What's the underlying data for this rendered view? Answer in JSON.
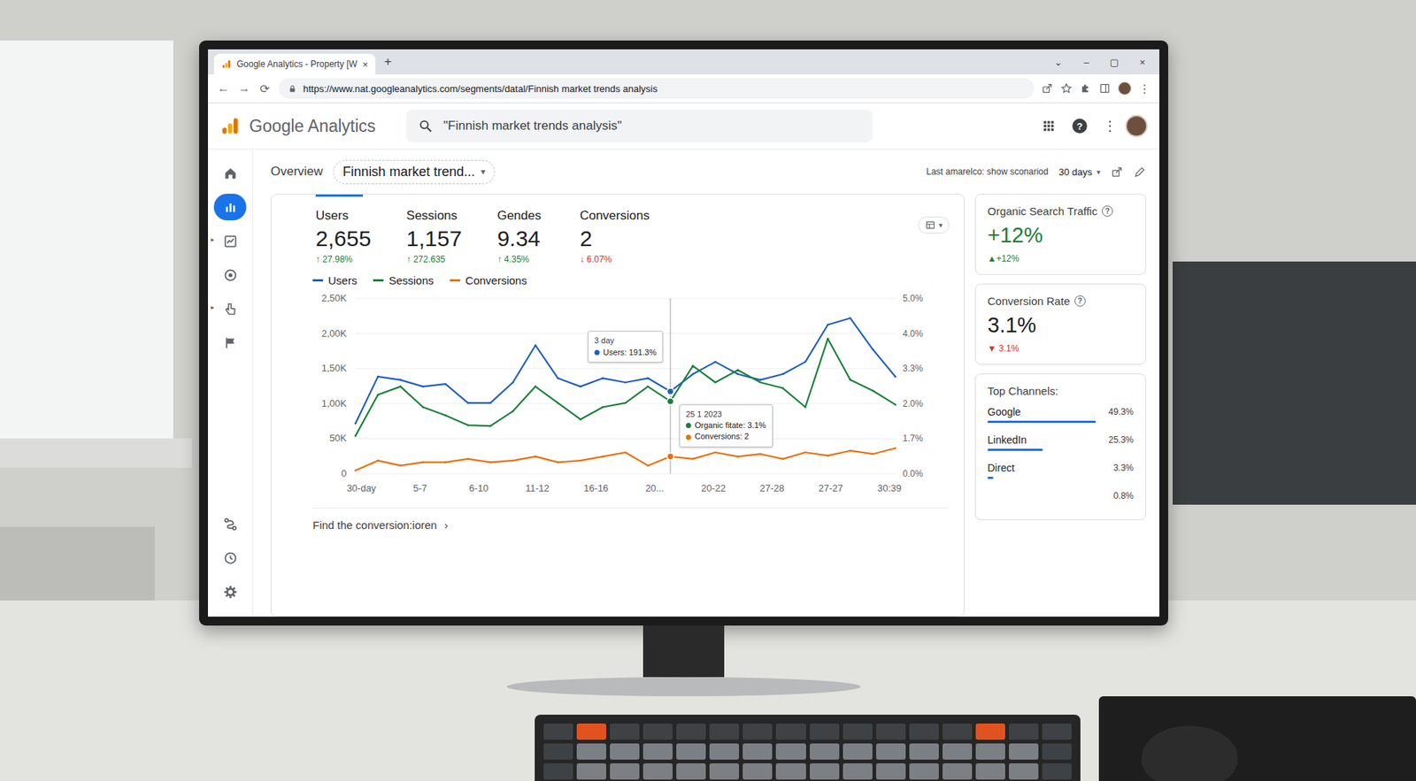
{
  "browser": {
    "tab": {
      "title": "Google Analytics - Property [W",
      "close": "×"
    },
    "new_tab": "+",
    "nav": [
      "←",
      "→",
      "⟳"
    ],
    "url": "https://www.nat.googleanalytics.com/segments/datal/Finnish market trends analysis",
    "menu": "⋮",
    "window_controls": [
      "⌄",
      "–",
      "▢",
      "×"
    ]
  },
  "header": {
    "logo": "Google Analytics",
    "search": "\"Finnish market trends analysis\"",
    "help": "?",
    "more": "⋮"
  },
  "sidebar": {
    "items": [
      {
        "selected": false
      },
      {
        "selected": true
      },
      {
        "selected": false,
        "arrow": "▸"
      },
      {
        "selected": false
      },
      {
        "selected": false,
        "arrow": "▸"
      },
      {
        "selected": false
      }
    ],
    "bottom": [
      {
        "selected": false
      },
      {
        "selected": false
      },
      {
        "selected": false
      }
    ]
  },
  "toolbar": {
    "overview": "Overview",
    "segment": "Finnish market trend...",
    "segment_arrow": "▾",
    "date_label": "Last amarelco: show sconariod",
    "date_value": "30 days",
    "date_arrow": "▾"
  },
  "metrics": [
    {
      "label": "Users",
      "value": "2,655",
      "delta": "↑ 27.98%",
      "trend": "up",
      "selected": true
    },
    {
      "label": "Sessions",
      "value": "1,157",
      "delta": "↑ 272.635",
      "trend": "up",
      "selected": false
    },
    {
      "label": "Gendes",
      "value": "9.34",
      "delta": "↑ 4.35%",
      "trend": "up",
      "selected": false
    },
    {
      "label": "Conversions",
      "value": "2",
      "delta": "↓ 6.07%",
      "trend": "down",
      "selected": false
    }
  ],
  "chart": {
    "menu_arrow": "▾",
    "series": [
      {
        "name": "Users",
        "color": "#1f5fbf",
        "values": [
          716,
          1385,
          1338,
          1244,
          1279,
          1009,
          1009,
          1303,
          1831,
          1362,
          1244,
          1362,
          1303,
          1362,
          1174,
          1420,
          1596,
          1420,
          1338,
          1420,
          1596,
          2124,
          2218,
          1772,
          1385
        ]
      },
      {
        "name": "Sessions",
        "color": "#188038",
        "values": [
          540,
          1127,
          1244,
          951,
          833,
          692,
          681,
          892,
          1244,
          1009,
          775,
          951,
          1009,
          1244,
          1033,
          1538,
          1303,
          1479,
          1303,
          1221,
          951,
          1925,
          1338,
          1185,
          986
        ]
      },
      {
        "name": "Conversions",
        "color": "#e8710a",
        "values": [
          47,
          188,
          117,
          164,
          164,
          211,
          164,
          188,
          246,
          164,
          188,
          246,
          305,
          117,
          246,
          211,
          305,
          246,
          282,
          211,
          305,
          258,
          329,
          282,
          364
        ]
      }
    ],
    "y_max": 2500,
    "y_ticks": [
      "2,50K",
      "2,00K",
      "1,50K",
      "1,00K",
      "50K",
      "0"
    ],
    "y2_ticks": [
      "5.0%",
      "4.0%",
      "3.3%",
      "2.0%",
      "1.7%",
      "0.0%"
    ],
    "x_ticks": [
      "30-day",
      "5-7",
      "6-10",
      "11-12",
      "16-16",
      "20...",
      "20-22",
      "27-28",
      "27-27",
      "30:39"
    ],
    "hover_index": 14,
    "tooltips": [
      {
        "title": "3 day",
        "rows": [
          {
            "text": "Users: 191.3%",
            "color": "#1f5fbf"
          }
        ]
      },
      {
        "title": "25 1 2023",
        "rows": [
          {
            "text": "Organic fitate: 3.1%",
            "color": "#188038"
          },
          {
            "text": "Conversions: 2",
            "color": "#e8710a"
          }
        ]
      }
    ],
    "footer": "Find the conversion:ioren",
    "footer_arrow": "›"
  },
  "cards": {
    "organic": {
      "title": "Organic Search Traffic",
      "help": "?",
      "value": "+12%",
      "delta": "▲+12%",
      "trend": "up"
    },
    "conversion": {
      "title": "Conversion Rate",
      "help": "?",
      "value": "3.1%",
      "delta": "▼ 3.1%",
      "trend": "down"
    },
    "channels": {
      "title": "Top Channels:",
      "items": [
        {
          "name": "Google",
          "reading": "49.3%",
          "level": 0.74
        },
        {
          "name": "LinkedIn",
          "reading": "25.3%",
          "level": 0.38
        },
        {
          "name": "Direct",
          "reading": "3.3%",
          "level": 0.04
        },
        {
          "reading": "0.8%",
          "level": 0.0
        }
      ]
    }
  }
}
